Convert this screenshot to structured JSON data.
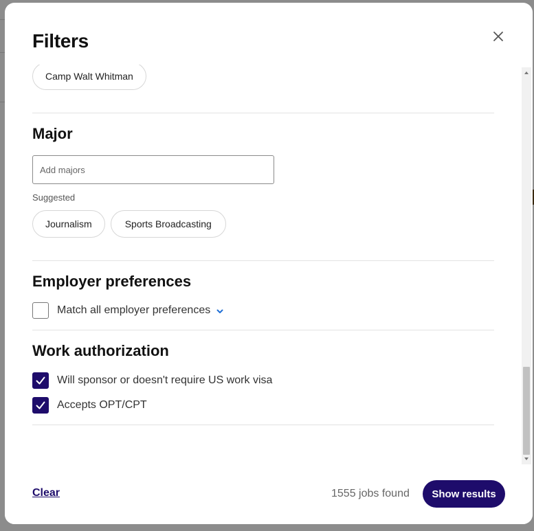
{
  "modal": {
    "title": "Filters"
  },
  "location": {
    "selected_chip": "Camp Walt Whitman"
  },
  "major": {
    "title": "Major",
    "input_placeholder": "Add majors",
    "suggested_label": "Suggested",
    "suggestions": [
      "Journalism",
      "Sports Broadcasting"
    ]
  },
  "employer_preferences": {
    "title": "Employer preferences",
    "checkbox_label": "Match all employer preferences",
    "checked": false
  },
  "work_authorization": {
    "title": "Work authorization",
    "options": [
      {
        "label": "Will sponsor or doesn't require US work visa",
        "checked": true
      },
      {
        "label": "Accepts OPT/CPT",
        "checked": true
      }
    ]
  },
  "footer": {
    "clear_label": "Clear",
    "jobs_found": "1555 jobs found",
    "show_results_label": "Show results"
  },
  "colors": {
    "accent": "#1e0c6b",
    "link_chevron": "#1f6fd6"
  },
  "icons": {
    "close": "close-icon",
    "chevron": "chevron-down-icon",
    "check": "checkmark-icon"
  }
}
